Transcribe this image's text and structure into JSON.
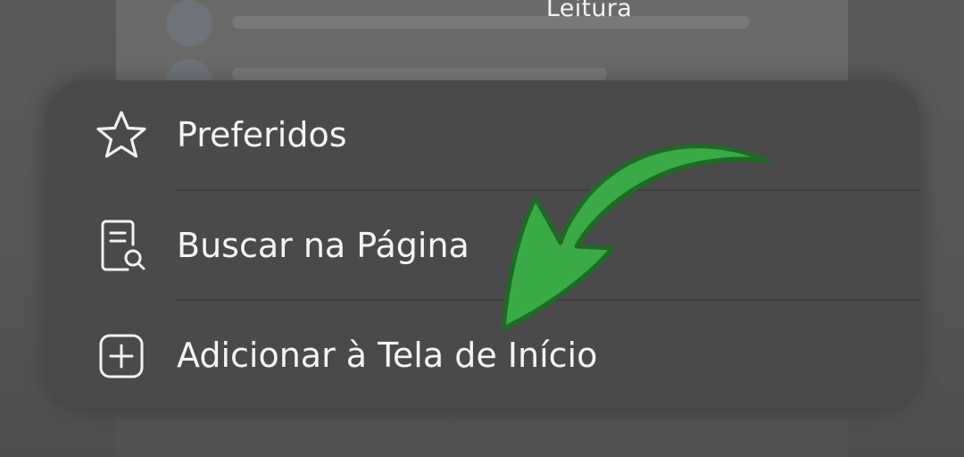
{
  "background": {
    "card_title": "Leitura"
  },
  "menu": {
    "items": [
      {
        "label": "Preferidos",
        "icon": "star-icon"
      },
      {
        "label": "Buscar na Página",
        "icon": "search-document-icon"
      },
      {
        "label": "Adicionar à Tela de Início",
        "icon": "add-square-icon"
      }
    ]
  },
  "annotation": {
    "arrow_color": "#3aaa46",
    "arrow_outline": "#1e6b24",
    "points_to": "Adicionar à Tela de Início"
  }
}
